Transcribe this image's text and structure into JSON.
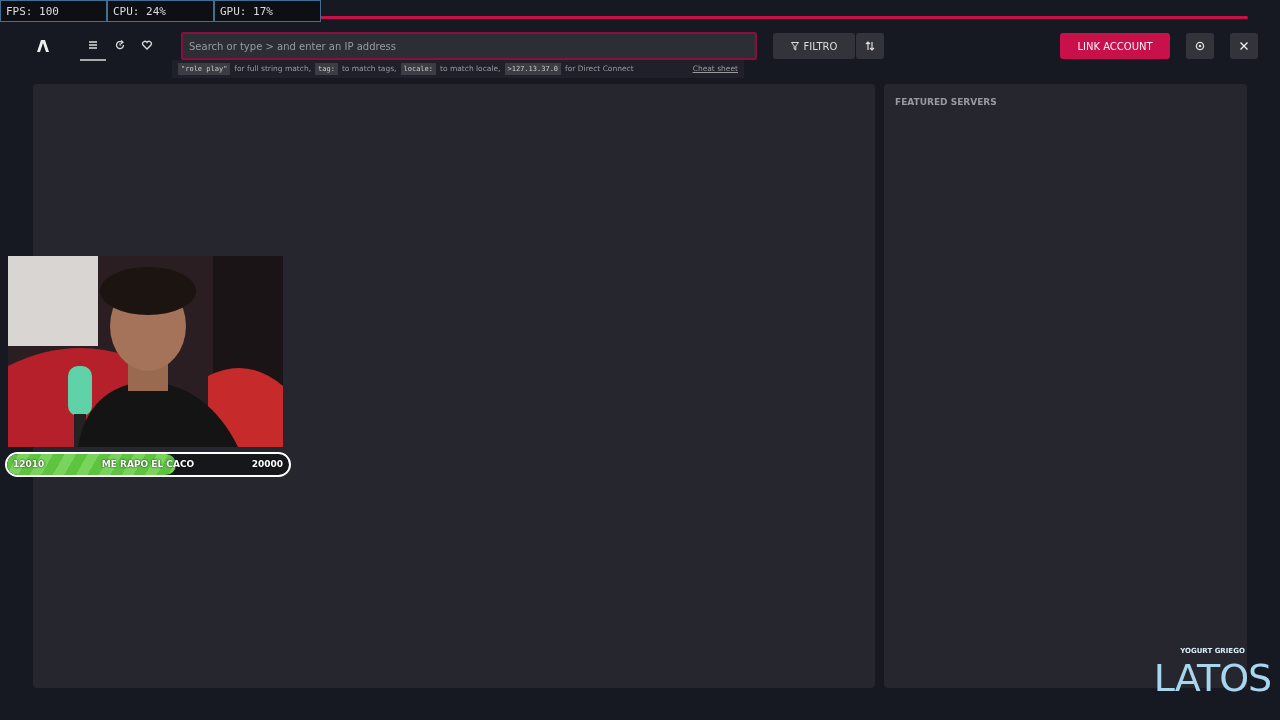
{
  "stats": [
    {
      "text": "FPS: 100"
    },
    {
      "text": "CPU: 24%"
    },
    {
      "text": "GPU: 17%"
    }
  ],
  "tabs": [
    {
      "selected": true
    },
    {
      "selected": false
    },
    {
      "selected": false
    }
  ],
  "search": {
    "placeholder": "Search or type > and enter an IP address",
    "hints": [
      {
        "code": "\"role play\"",
        "text": "for full string match,"
      },
      {
        "code": "tag:",
        "text": "to match tags,"
      },
      {
        "code": "locale:",
        "text": "to match locale,"
      },
      {
        "code": ">127.13.37.0",
        "text": "for Direct Connect"
      }
    ],
    "cheat_sheet": "Cheat sheet"
  },
  "filter_button": "FILTRO",
  "link_account": "LINK ACCOUNT",
  "featured": {
    "title": "FEATURED SERVERS"
  },
  "goal": {
    "current": "12010",
    "title": "ME RAPO EL CACO",
    "target": "20000",
    "level": 0.6
  },
  "logo": {
    "tagline": "YOGURT GRIEGO",
    "name": "LATOS"
  }
}
